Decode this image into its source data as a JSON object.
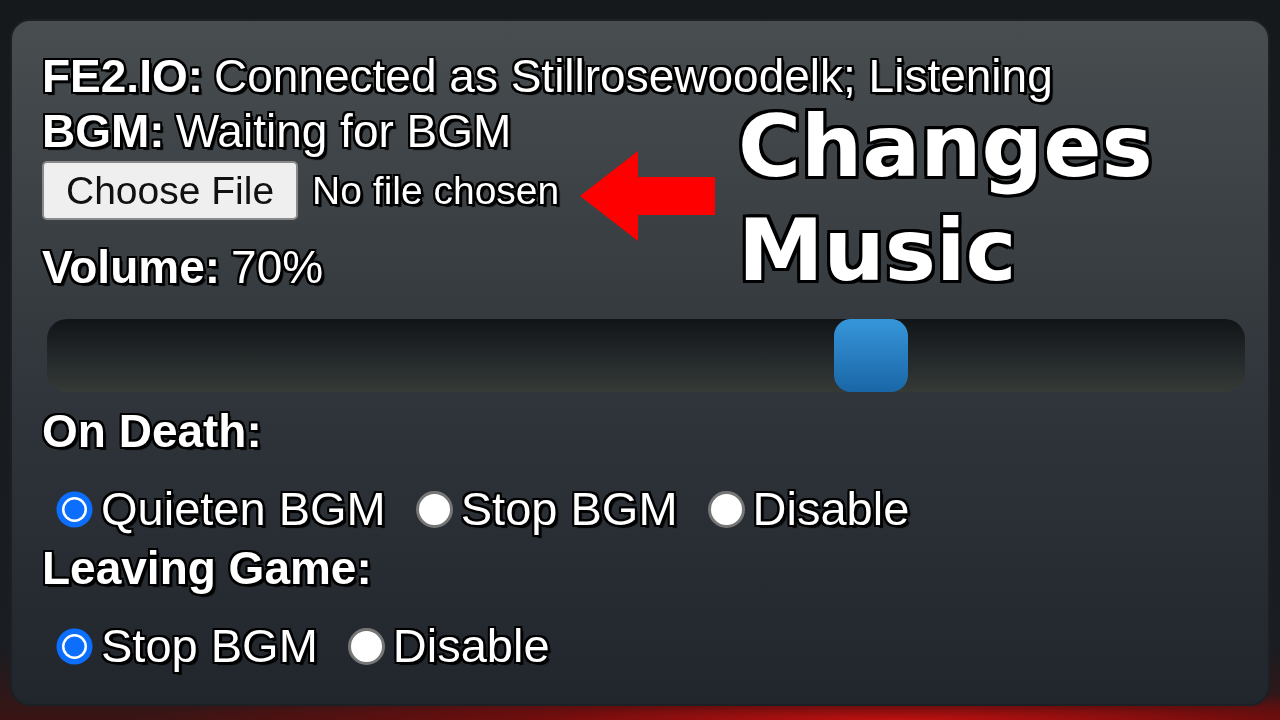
{
  "status": [
    {
      "label": "FE2.IO:",
      "value": "Connected as Stillrosewoodelk; Listening"
    },
    {
      "label": "BGM:",
      "value": "Waiting for BGM"
    }
  ],
  "file_input": {
    "button": "Choose File",
    "status": "No file chosen"
  },
  "volume": {
    "label": "Volume:",
    "reading": "70%",
    "level": 0.7
  },
  "option_groups": [
    {
      "title": "On Death:",
      "options": [
        {
          "label": "Quieten BGM",
          "selected": true
        },
        {
          "label": "Stop BGM",
          "selected": false
        },
        {
          "label": "Disable",
          "selected": false
        }
      ]
    },
    {
      "title": "Leaving Game:",
      "options": [
        {
          "label": "Stop BGM",
          "selected": true
        },
        {
          "label": "Disable",
          "selected": false
        }
      ]
    }
  ],
  "caption": {
    "lines": [
      "Changes",
      "Music"
    ]
  }
}
